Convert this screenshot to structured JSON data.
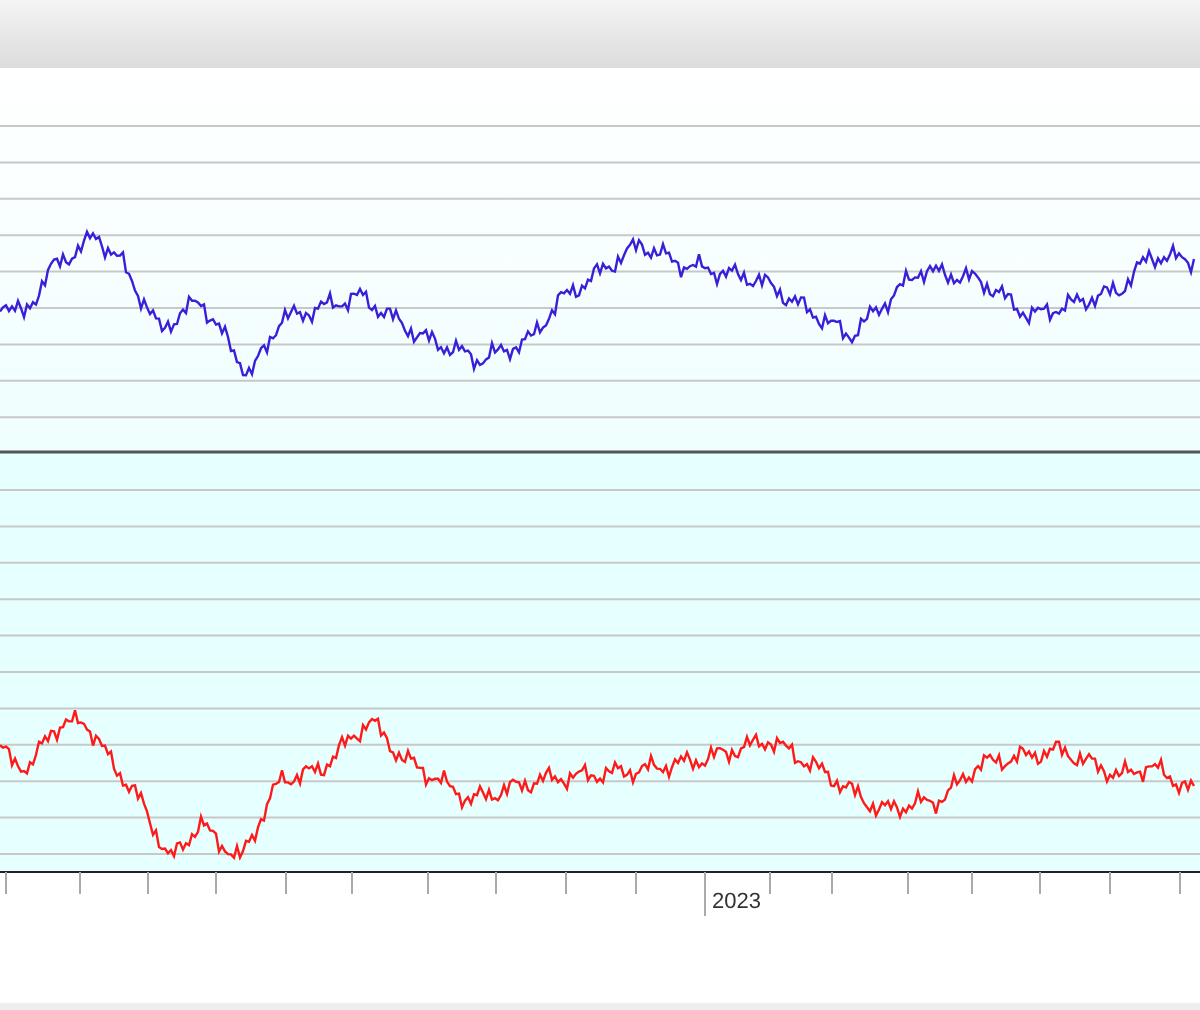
{
  "chart": {
    "x_axis_labels": [
      "2023"
    ]
  }
}
